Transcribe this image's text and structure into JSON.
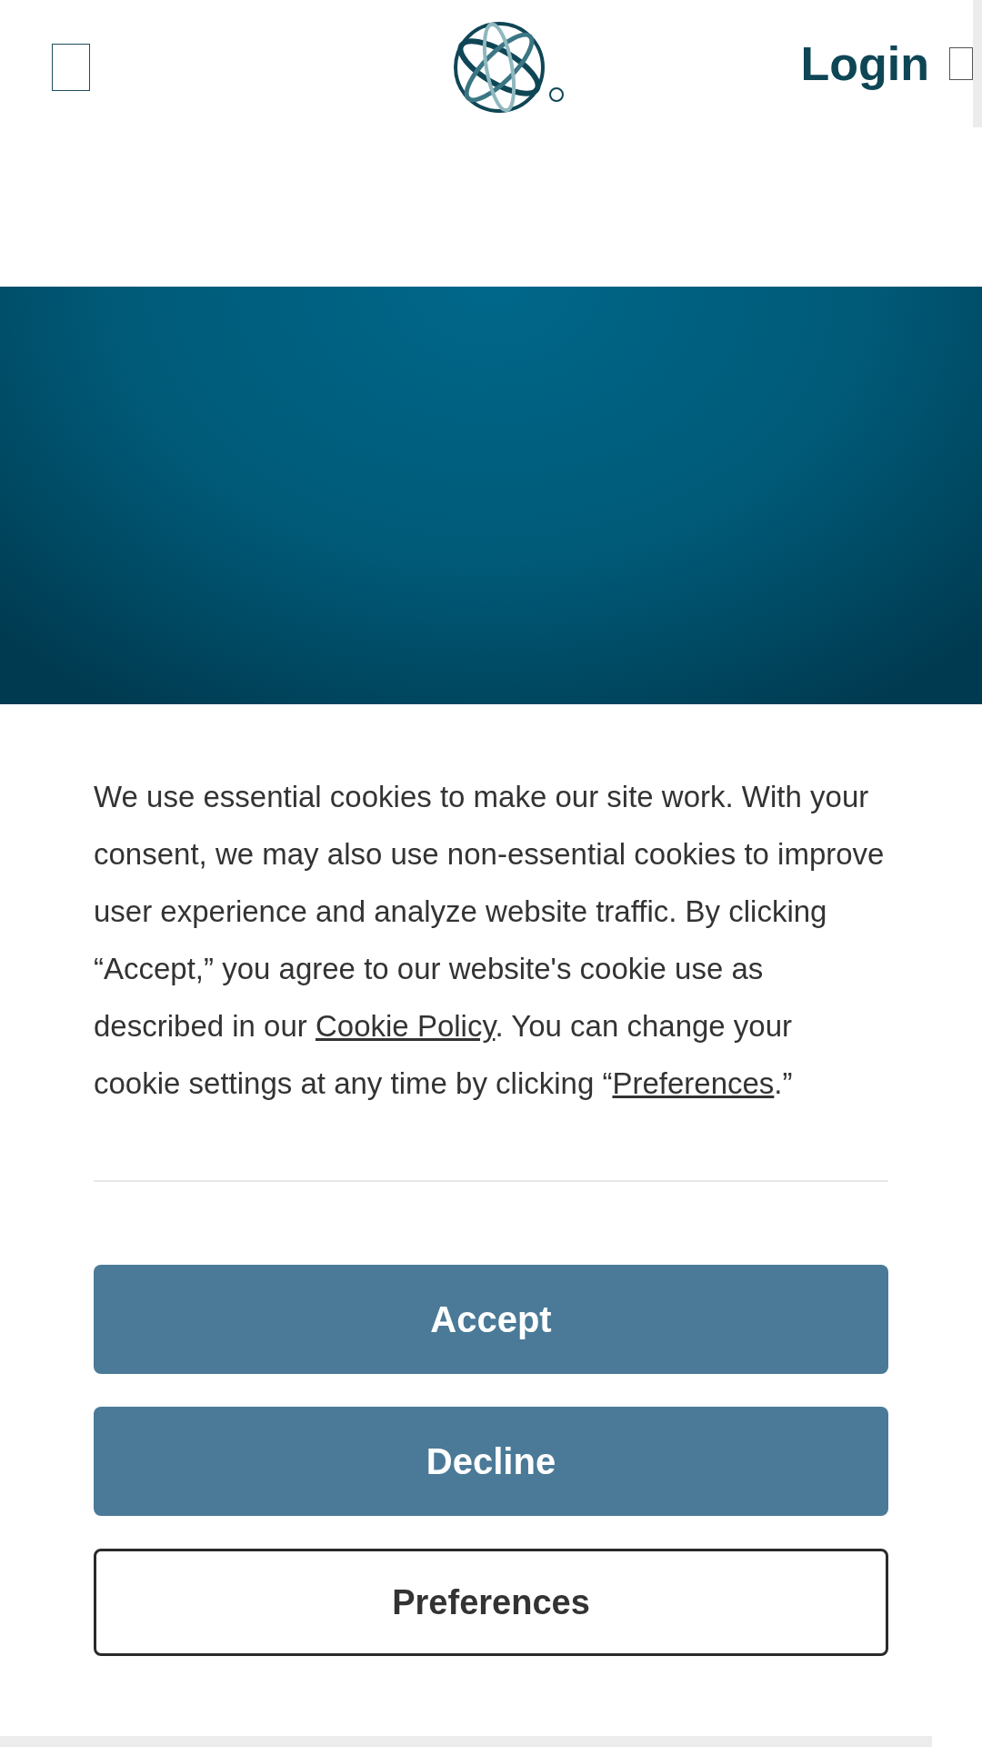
{
  "header": {
    "login": "Login"
  },
  "consent": {
    "segments": [
      {
        "kind": "text",
        "text": "We use essential cookies to make our site work. With your consent, we may also use non-essential cookies to improve user experience and analyze website traffic. By clicking “Accept,” you agree to our website's cookie use as described in our "
      },
      {
        "kind": "link",
        "text": "Cookie Policy"
      },
      {
        "kind": "text",
        "text": ". You can change your cookie settings at any time by clicking “"
      },
      {
        "kind": "link",
        "text": "Preferences"
      },
      {
        "kind": "text",
        "text": ".”"
      }
    ],
    "buttons": [
      {
        "label": "Accept",
        "kind": "filled"
      },
      {
        "label": "Decline",
        "kind": "filled"
      },
      {
        "label": "Preferences",
        "kind": "outline"
      }
    ]
  }
}
